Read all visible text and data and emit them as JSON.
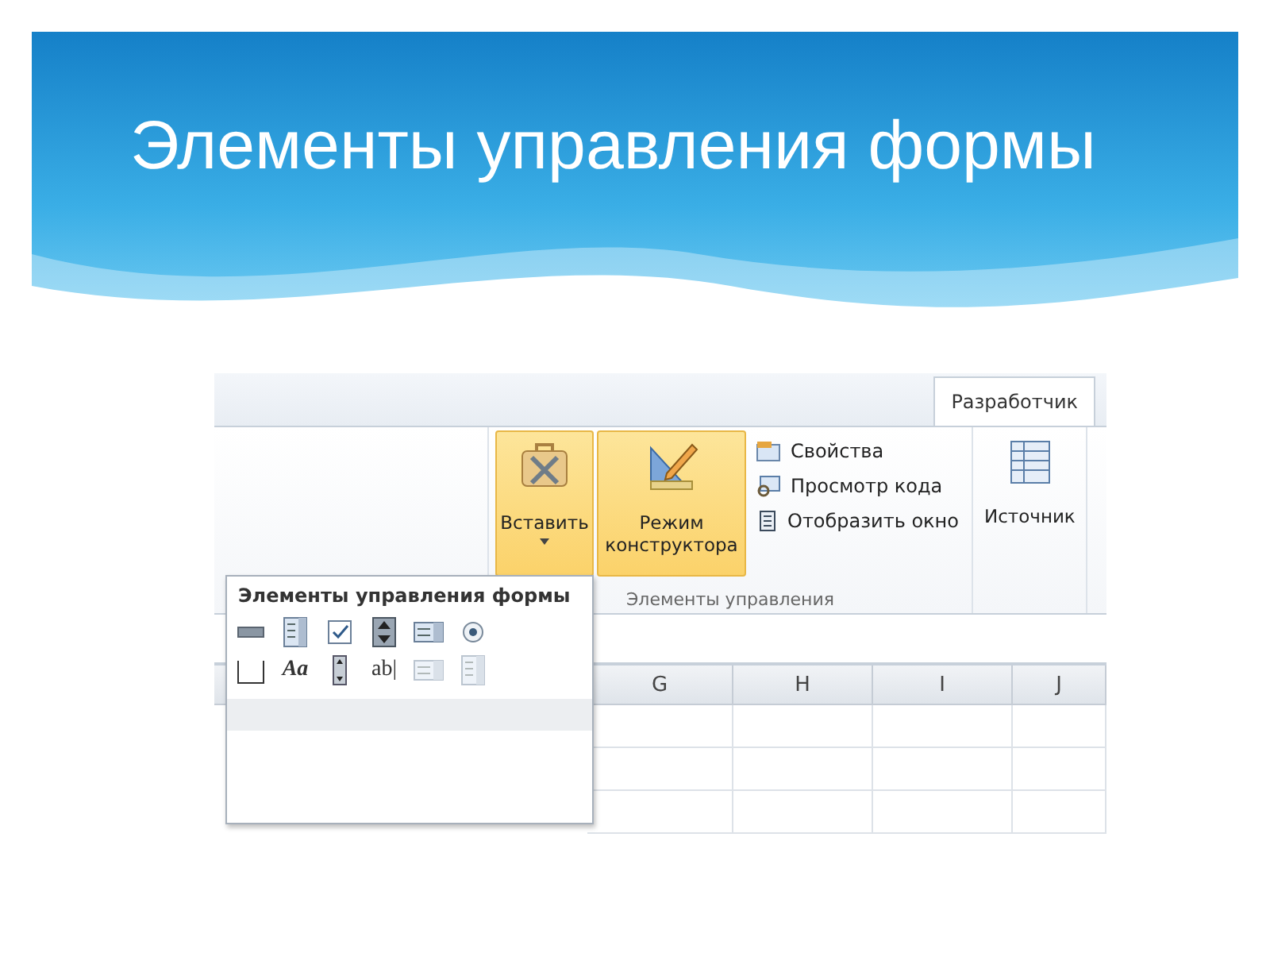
{
  "slide": {
    "title": "Элементы управления формы"
  },
  "ribbon": {
    "tab": {
      "label": "Разработчик",
      "selected": true
    },
    "large_buttons": [
      {
        "label": "Вставить",
        "kind": "insert",
        "highlighted": true,
        "dropdown": true
      },
      {
        "label": "Режим конструктора",
        "kind": "design",
        "highlighted": true,
        "dropdown": false
      }
    ],
    "small_buttons": [
      {
        "label": "Свойства",
        "kind": "properties"
      },
      {
        "label": "Просмотр кода",
        "kind": "code"
      },
      {
        "label": "Отобразить окно",
        "kind": "window"
      }
    ],
    "group_label": "Элементы управления",
    "source_button": {
      "label": "Источник",
      "highlighted": false
    }
  },
  "sheet": {
    "columns": [
      "G",
      "H",
      "I",
      "J"
    ]
  },
  "popup": {
    "title": "Элементы управления формы",
    "rows": [
      [
        {
          "kind": "button",
          "disabled": false
        },
        {
          "kind": "combo",
          "disabled": false
        },
        {
          "kind": "checkbox",
          "disabled": false
        },
        {
          "kind": "spin",
          "disabled": false
        },
        {
          "kind": "list",
          "disabled": false
        },
        {
          "kind": "radio",
          "disabled": false
        }
      ],
      [
        {
          "kind": "group",
          "disabled": false
        },
        {
          "kind": "label",
          "glyph": "Aa",
          "disabled": false
        },
        {
          "kind": "scroll",
          "disabled": false
        },
        {
          "kind": "textbox",
          "glyph": "ab|",
          "disabled": false
        },
        {
          "kind": "list",
          "disabled": true
        },
        {
          "kind": "combo",
          "disabled": true
        }
      ]
    ]
  }
}
